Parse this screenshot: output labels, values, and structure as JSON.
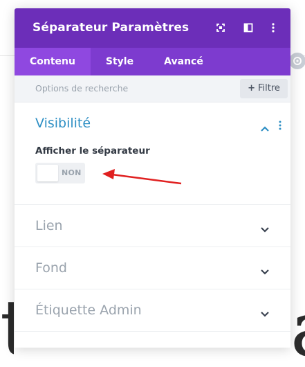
{
  "modal": {
    "title": "Séparateur Paramètres",
    "header_icons": [
      "fullscreen-icon",
      "split-view-icon",
      "more-vertical-icon"
    ],
    "accent_header": "#6c2eb9",
    "accent_tabs": "#7d3bcf",
    "accent_tab_active": "#8f48e0"
  },
  "tabs": [
    {
      "label": "Contenu",
      "active": true
    },
    {
      "label": "Style",
      "active": false
    },
    {
      "label": "Avancé",
      "active": false
    }
  ],
  "search": {
    "placeholder": "Options de recherche",
    "filter_label": "Filtre"
  },
  "sections": {
    "visibility": {
      "title": "Visibilité",
      "expanded": true,
      "field_label": "Afficher le séparateur",
      "toggle_value": "NON"
    },
    "link": {
      "title": "Lien",
      "expanded": false
    },
    "background": {
      "title": "Fond",
      "expanded": false
    },
    "admin_label": {
      "title": "Étiquette Admin",
      "expanded": false
    }
  },
  "annotation": {
    "arrow_color": "#e02020"
  },
  "colors": {
    "section_open_title": "#2e8fc4",
    "section_closed_title": "#9aa3ad"
  }
}
